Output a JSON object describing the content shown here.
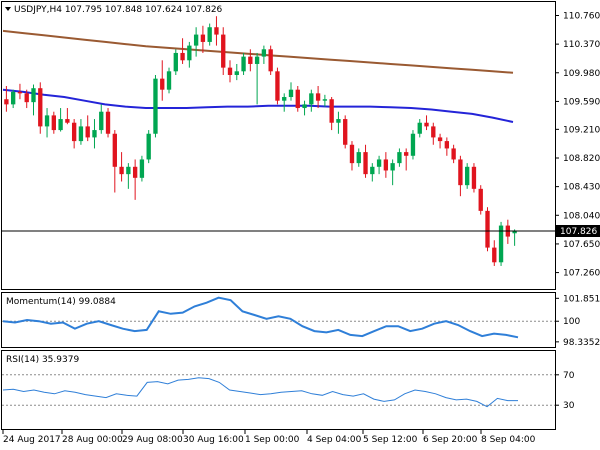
{
  "chart_data": [
    {
      "type": "candlestick",
      "title": "USDJPY,H4  107.795 107.848 107.624 107.826",
      "symbol": "USDJPY",
      "timeframe": "H4",
      "ohlc_current": [
        107.795,
        107.848,
        107.624,
        107.826
      ],
      "current_price_label": "107.826",
      "ylim": [
        107.05,
        110.93
      ],
      "y_ticks": [
        "110.760",
        "110.370",
        "109.980",
        "109.590",
        "109.210",
        "108.820",
        "108.430",
        "108.040",
        "107.650",
        "107.260"
      ],
      "x_ticks": [
        "24 Aug 2017",
        "28 Aug 00:00",
        "29 Aug 08:00",
        "30 Aug 16:00",
        "1 Sep 00:00",
        "4 Sep 04:00",
        "5 Sep 12:00",
        "6 Sep 20:00",
        "8 Sep 04:00"
      ],
      "colors": {
        "bull": "#00a651",
        "bear": "#e0141e",
        "ma_slow": "#9a5a32",
        "ma_fast": "#2424d8"
      },
      "candles": [
        [
          109.62,
          109.8,
          109.45,
          109.55
        ],
        [
          109.55,
          109.75,
          109.5,
          109.72
        ],
        [
          109.72,
          109.83,
          109.62,
          109.7
        ],
        [
          109.7,
          109.75,
          109.5,
          109.58
        ],
        [
          109.58,
          109.82,
          109.4,
          109.77
        ],
        [
          109.77,
          109.85,
          109.15,
          109.25
        ],
        [
          109.25,
          109.5,
          109.1,
          109.4
        ],
        [
          109.4,
          109.45,
          109.15,
          109.2
        ],
        [
          109.2,
          109.5,
          109.18,
          109.35
        ],
        [
          109.35,
          109.5,
          109.28,
          109.3
        ],
        [
          109.3,
          109.35,
          108.95,
          109.05
        ],
        [
          109.05,
          109.35,
          109.0,
          109.25
        ],
        [
          109.25,
          109.4,
          109.05,
          109.1
        ],
        [
          109.1,
          109.35,
          108.95,
          109.2
        ],
        [
          109.2,
          109.55,
          109.15,
          109.45
        ],
        [
          109.45,
          109.5,
          109.1,
          109.15
        ],
        [
          109.15,
          109.2,
          108.35,
          108.7
        ],
        [
          108.7,
          108.9,
          108.5,
          108.6
        ],
        [
          108.6,
          108.75,
          108.4,
          108.7
        ],
        [
          108.7,
          108.8,
          108.25,
          108.55
        ],
        [
          108.55,
          108.85,
          108.5,
          108.8
        ],
        [
          108.8,
          109.2,
          108.75,
          109.15
        ],
        [
          109.15,
          109.95,
          109.1,
          109.9
        ],
        [
          109.9,
          110.15,
          109.6,
          109.75
        ],
        [
          109.75,
          110.05,
          109.7,
          110.0
        ],
        [
          110.0,
          110.3,
          109.95,
          110.25
        ],
        [
          110.25,
          110.45,
          110.1,
          110.15
        ],
        [
          110.15,
          110.4,
          110.05,
          110.35
        ],
        [
          110.35,
          110.6,
          110.2,
          110.5
        ],
        [
          110.5,
          110.62,
          110.25,
          110.4
        ],
        [
          110.4,
          110.65,
          110.35,
          110.6
        ],
        [
          110.6,
          110.75,
          110.35,
          110.5
        ],
        [
          110.5,
          110.6,
          109.95,
          110.05
        ],
        [
          110.05,
          110.15,
          109.85,
          109.95
        ],
        [
          109.95,
          110.1,
          109.88,
          110.0
        ],
        [
          110.0,
          110.25,
          109.95,
          110.2
        ],
        [
          110.2,
          110.3,
          110.0,
          110.1
        ],
        [
          110.1,
          110.25,
          109.55,
          110.2
        ],
        [
          110.2,
          110.35,
          110.1,
          110.3
        ],
        [
          110.3,
          110.35,
          109.95,
          110.0
        ],
        [
          110.0,
          110.05,
          109.55,
          109.6
        ],
        [
          109.6,
          109.7,
          109.45,
          109.65
        ],
        [
          109.65,
          109.85,
          109.6,
          109.75
        ],
        [
          109.75,
          109.8,
          109.45,
          109.5
        ],
        [
          109.5,
          109.6,
          109.4,
          109.55
        ],
        [
          109.55,
          109.75,
          109.45,
          109.7
        ],
        [
          109.7,
          109.8,
          109.5,
          109.6
        ],
        [
          109.6,
          109.68,
          109.52,
          109.62
        ],
        [
          109.62,
          109.65,
          109.2,
          109.3
        ],
        [
          109.3,
          109.45,
          109.15,
          109.35
        ],
        [
          109.35,
          109.4,
          108.95,
          109.0
        ],
        [
          109.0,
          109.05,
          108.65,
          108.75
        ],
        [
          108.75,
          108.95,
          108.7,
          108.9
        ],
        [
          108.9,
          109.0,
          108.55,
          108.6
        ],
        [
          108.6,
          108.75,
          108.5,
          108.7
        ],
        [
          108.7,
          108.85,
          108.6,
          108.8
        ],
        [
          108.8,
          108.9,
          108.55,
          108.65
        ],
        [
          108.65,
          108.8,
          108.45,
          108.75
        ],
        [
          108.75,
          108.95,
          108.7,
          108.9
        ],
        [
          108.9,
          108.95,
          108.65,
          108.85
        ],
        [
          108.85,
          109.2,
          108.8,
          109.15
        ],
        [
          109.15,
          109.35,
          109.1,
          109.3
        ],
        [
          109.3,
          109.4,
          109.2,
          109.25
        ],
        [
          109.25,
          109.3,
          109.0,
          109.1
        ],
        [
          109.1,
          109.15,
          108.95,
          109.05
        ],
        [
          109.05,
          109.1,
          108.85,
          108.95
        ],
        [
          108.95,
          109.0,
          108.75,
          108.8
        ],
        [
          108.8,
          108.85,
          108.3,
          108.45
        ],
        [
          108.45,
          108.75,
          108.4,
          108.7
        ],
        [
          108.7,
          108.75,
          108.35,
          108.4
        ],
        [
          108.4,
          108.45,
          108.05,
          108.1
        ],
        [
          108.1,
          108.15,
          107.55,
          107.6
        ],
        [
          107.6,
          107.7,
          107.35,
          107.4
        ],
        [
          107.4,
          107.95,
          107.35,
          107.9
        ],
        [
          107.9,
          107.98,
          107.65,
          107.75
        ],
        [
          107.795,
          107.848,
          107.624,
          107.826
        ]
      ],
      "ma_slow": [
        110.55,
        110.52,
        110.49,
        110.46,
        110.43,
        110.4,
        110.37,
        110.34,
        110.32,
        110.3,
        110.28,
        110.26,
        110.24,
        110.22,
        110.2,
        110.18,
        110.16,
        110.14,
        110.12,
        110.1,
        110.08,
        110.06,
        110.04,
        110.02,
        110.0,
        109.98
      ],
      "ma_fast": [
        109.75,
        109.72,
        109.68,
        109.65,
        109.6,
        109.55,
        109.52,
        109.5,
        109.5,
        109.5,
        109.51,
        109.52,
        109.52,
        109.53,
        109.53,
        109.53,
        109.52,
        109.52,
        109.52,
        109.51,
        109.5,
        109.48,
        109.45,
        109.42,
        109.37,
        109.31
      ]
    },
    {
      "type": "line",
      "title": "Momentum(14) 99.0884",
      "ylim": [
        98.0,
        102.2
      ],
      "y_ticks": [
        "101.8517",
        "100",
        "98.3352"
      ],
      "reference_level": 100,
      "color": "#2f7fd8",
      "values": [
        100.0,
        99.9,
        100.1,
        100.0,
        99.8,
        99.9,
        99.4,
        99.8,
        100.0,
        99.7,
        99.4,
        99.2,
        99.3,
        100.8,
        100.6,
        100.7,
        101.2,
        101.5,
        101.9,
        101.7,
        100.8,
        100.5,
        100.2,
        100.4,
        100.2,
        99.6,
        99.2,
        99.1,
        99.3,
        98.9,
        98.8,
        99.2,
        99.6,
        99.6,
        99.2,
        99.4,
        99.8,
        100.0,
        99.7,
        99.2,
        98.8,
        99.0,
        98.9,
        98.7
      ]
    },
    {
      "type": "line",
      "title": "RSI(14) 35.9379",
      "ylim": [
        0,
        100
      ],
      "y_ticks": [
        "70",
        "30"
      ],
      "reference_levels": [
        70,
        30
      ],
      "color": "#2f7fd8",
      "values": [
        50,
        51,
        48,
        50,
        47,
        45,
        49,
        47,
        44,
        42,
        40,
        45,
        43,
        42,
        60,
        61,
        58,
        63,
        64,
        66,
        65,
        60,
        50,
        48,
        46,
        44,
        45,
        47,
        48,
        49,
        45,
        43,
        48,
        44,
        42,
        45,
        38,
        35,
        37,
        45,
        50,
        48,
        45,
        40,
        37,
        38,
        35,
        28,
        39,
        36,
        36
      ]
    }
  ]
}
